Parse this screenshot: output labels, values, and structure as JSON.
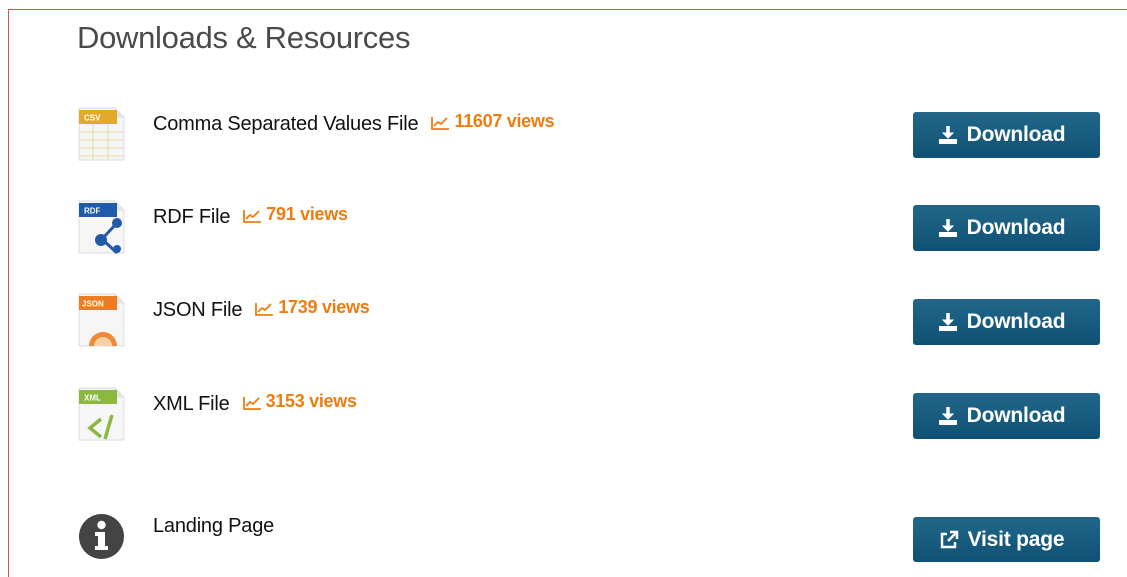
{
  "section": {
    "title": "Downloads & Resources"
  },
  "resources": [
    {
      "file_name": "Comma Separated Values File",
      "badge": "CSV",
      "views": "11607 views",
      "button_label": "Download",
      "icon": "csv-file-icon",
      "color": "#e3a928"
    },
    {
      "file_name": "RDF File",
      "badge": "RDF",
      "views": "791 views",
      "button_label": "Download",
      "icon": "rdf-file-icon",
      "color": "#1f5ba8"
    },
    {
      "file_name": "JSON File",
      "badge": "JSON",
      "views": "1739 views",
      "button_label": "Download",
      "icon": "json-file-icon",
      "color": "#ee7d22"
    },
    {
      "file_name": "XML File",
      "badge": "XML",
      "views": "3153 views",
      "button_label": "Download",
      "icon": "xml-file-icon",
      "color": "#8bb83f"
    }
  ],
  "landing": {
    "label": "Landing Page",
    "button_label": "Visit page",
    "icon": "info-circle-icon",
    "button_icon": "external-link-icon"
  },
  "colors": {
    "button": "#1a5f84",
    "views": "#ee7d10",
    "frame_border": "#d9534f"
  }
}
